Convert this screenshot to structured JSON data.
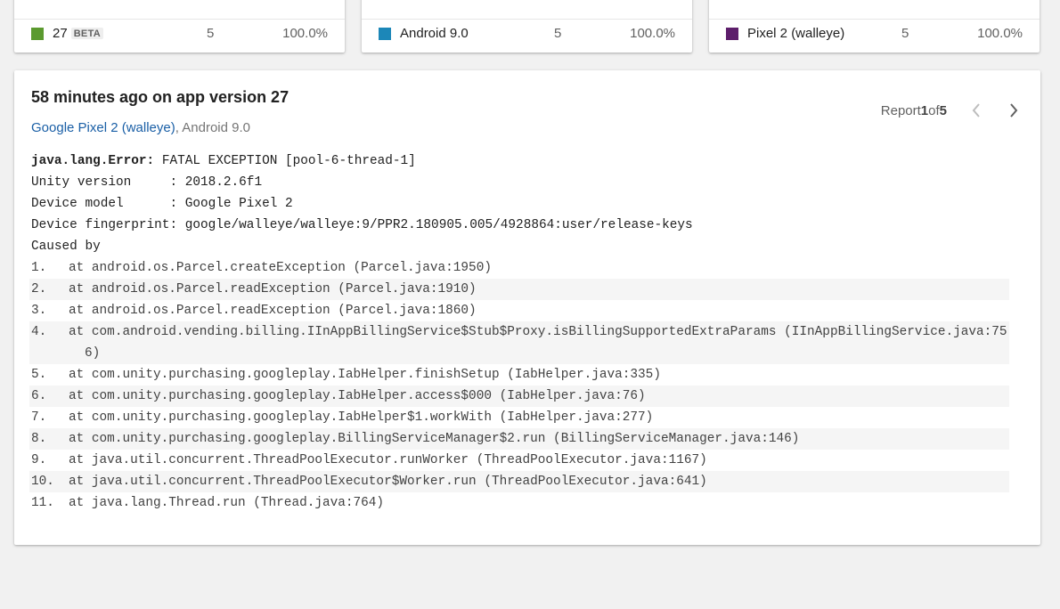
{
  "top_cards": [
    {
      "swatch_color": "#5b9a2f",
      "label": "27",
      "badge": "BETA",
      "count": "5",
      "percent": "100.0%"
    },
    {
      "swatch_color": "#1c87b8",
      "label": "Android 9.0",
      "badge": null,
      "count": "5",
      "percent": "100.0%"
    },
    {
      "swatch_color": "#5d1e6b",
      "label": "Pixel 2 (walleye)",
      "badge": null,
      "count": "5",
      "percent": "100.0%"
    }
  ],
  "report": {
    "title": "58 minutes ago on app version 27",
    "device_link": "Google Pixel 2 (walleye)",
    "separator": ", ",
    "os": "Android 9.0",
    "pager": {
      "prefix": "Report ",
      "current": "1",
      "of": " of ",
      "total": "5",
      "prev_icon": "chevron-left-icon",
      "next_icon": "chevron-right-icon"
    }
  },
  "stack_trace": {
    "exception_type": "java.lang.Error:",
    "exception_message": " FATAL EXCEPTION [pool-6-thread-1]",
    "header_lines": [
      "Unity version     : 2018.2.6f1",
      "Device model      : Google Pixel 2",
      "Device fingerprint: google/walleye/walleye:9/PPR2.180905.005/4928864:user/release-keys",
      "Caused by"
    ],
    "frames": [
      {
        "num": "1.",
        "text": "at android.os.Parcel.createException (Parcel.java:1950)"
      },
      {
        "num": "2.",
        "text": "at android.os.Parcel.readException (Parcel.java:1910)"
      },
      {
        "num": "3.",
        "text": "at android.os.Parcel.readException (Parcel.java:1860)"
      },
      {
        "num": "4.",
        "text": "at com.android.vending.billing.IInAppBillingService$Stub$Proxy.isBillingSupportedExtraParams (IInAppBillingService.java:756)"
      },
      {
        "num": "5.",
        "text": "at com.unity.purchasing.googleplay.IabHelper.finishSetup (IabHelper.java:335)"
      },
      {
        "num": "6.",
        "text": "at com.unity.purchasing.googleplay.IabHelper.access$000 (IabHelper.java:76)"
      },
      {
        "num": "7.",
        "text": "at com.unity.purchasing.googleplay.IabHelper$1.workWith (IabHelper.java:277)"
      },
      {
        "num": "8.",
        "text": "at com.unity.purchasing.googleplay.BillingServiceManager$2.run (BillingServiceManager.java:146)"
      },
      {
        "num": "9.",
        "text": "at java.util.concurrent.ThreadPoolExecutor.runWorker (ThreadPoolExecutor.java:1167)"
      },
      {
        "num": "10.",
        "text": "at java.util.concurrent.ThreadPoolExecutor$Worker.run (ThreadPoolExecutor.java:641)"
      },
      {
        "num": "11.",
        "text": "at java.lang.Thread.run (Thread.java:764)"
      }
    ]
  }
}
